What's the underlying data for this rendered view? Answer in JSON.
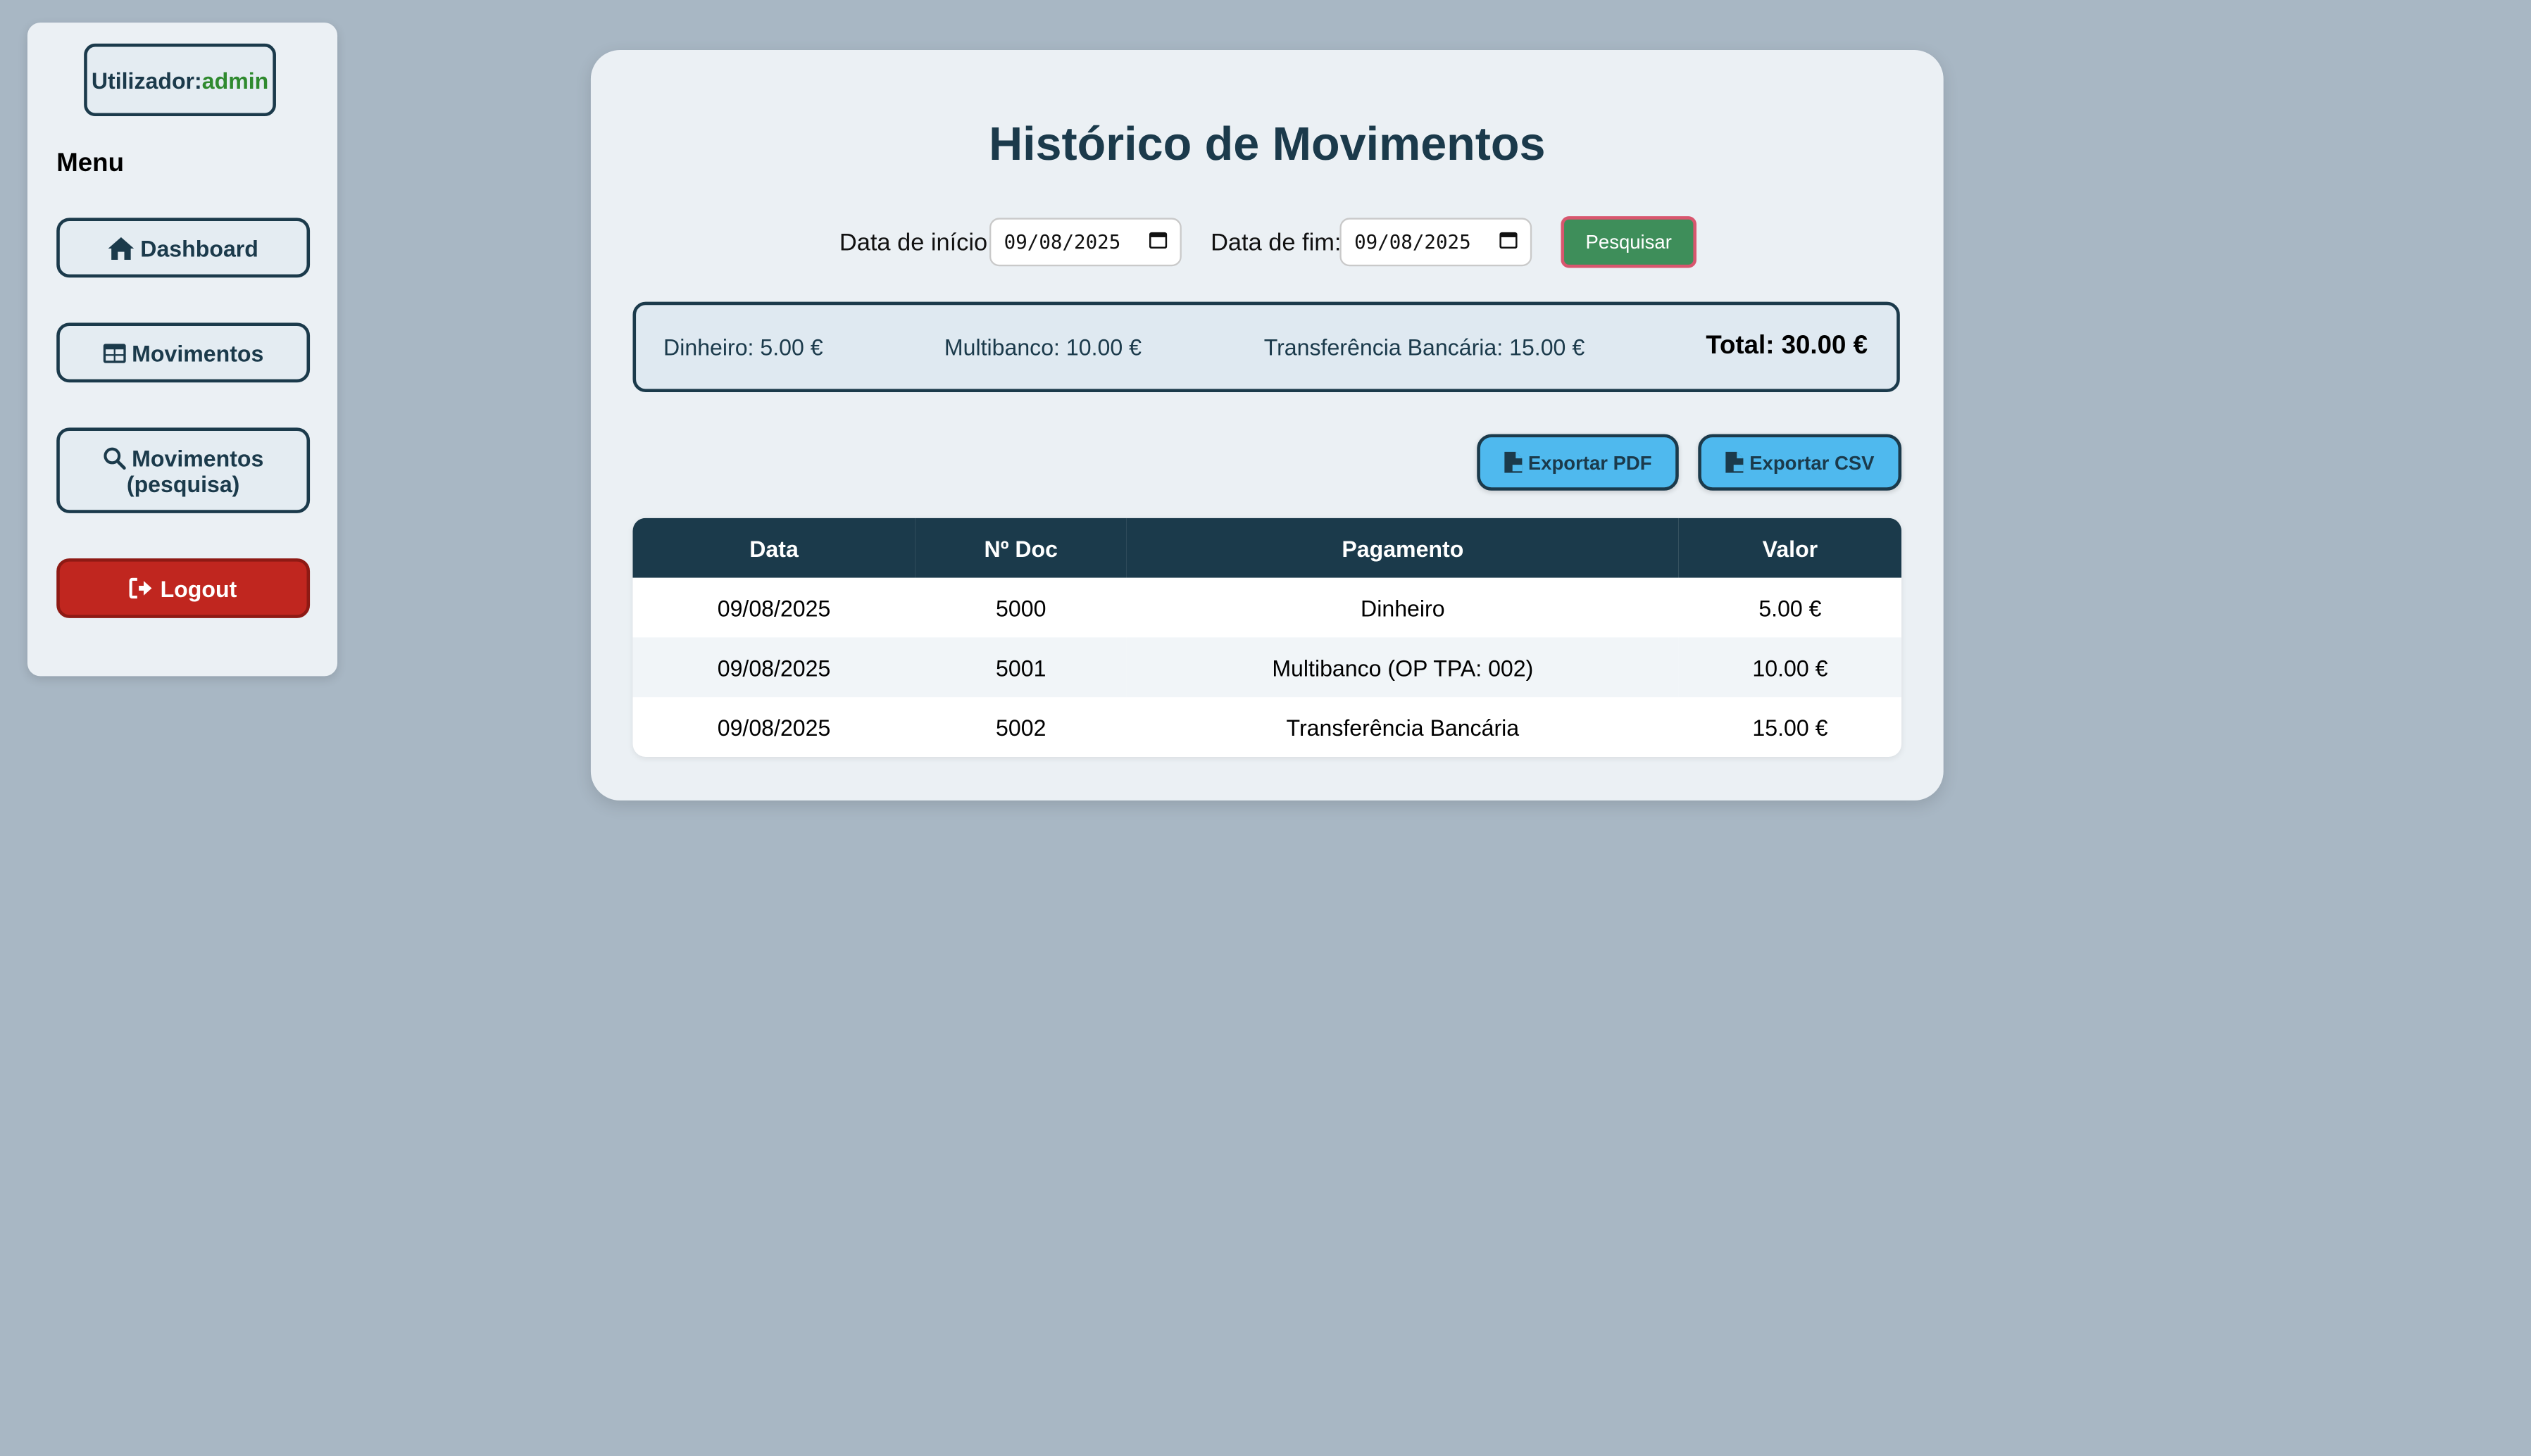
{
  "sidebar": {
    "user_label": "Utilizador:",
    "user_name": "admin",
    "menu_title": "Menu",
    "items": [
      {
        "label": "Dashboard",
        "icon": "home-icon"
      },
      {
        "label": "Movimentos",
        "icon": "table-icon"
      },
      {
        "label_line1": "Movimentos",
        "label_line2": "(pesquisa)",
        "icon": "search-icon"
      },
      {
        "label": "Logout",
        "icon": "logout-icon"
      }
    ]
  },
  "main": {
    "title": "Histórico de Movimentos",
    "filters": {
      "start_label": "Data de início:",
      "start_value": "09/08/2025",
      "end_label": "Data de fim:",
      "end_value": "09/08/2025",
      "search_label": "Pesquisar"
    },
    "summary": {
      "dinheiro": "Dinheiro: 5.00 €",
      "multibanco": "Multibanco: 10.00 €",
      "transferencia": "Transferência Bancária: 15.00 €",
      "total": "Total: 30.00 €"
    },
    "export": {
      "pdf_label": "Exportar PDF",
      "csv_label": "Exportar CSV"
    },
    "table": {
      "columns": [
        "Data",
        "Nº Doc",
        "Pagamento",
        "Valor"
      ],
      "rows": [
        [
          "09/08/2025",
          "5000",
          "Dinheiro",
          "5.00 €"
        ],
        [
          "09/08/2025",
          "5001",
          "Multibanco (OP TPA: 002)",
          "10.00 €"
        ],
        [
          "09/08/2025",
          "5002",
          "Transferência Bancária",
          "15.00 €"
        ]
      ]
    }
  },
  "colors": {
    "background": "#a8b7c4",
    "panel": "#ebf0f4",
    "primary_dark": "#1b3a4b",
    "accent_green": "#3e8e5a",
    "logout_red": "#c0261f",
    "export_blue": "#4fb9ee",
    "username_green": "#2f8a2f"
  }
}
